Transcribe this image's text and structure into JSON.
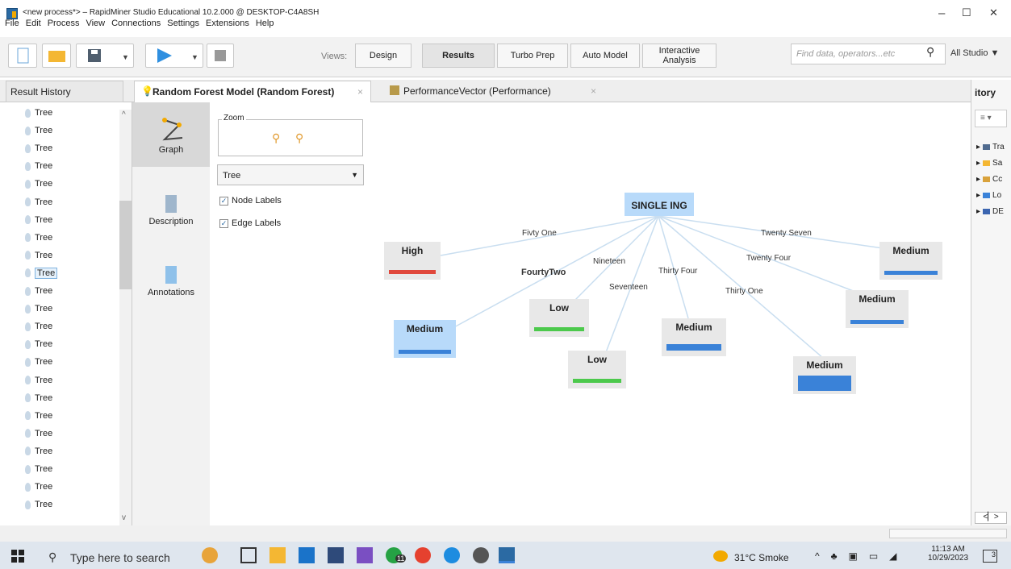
{
  "window": {
    "title": "<new process*> – RapidMiner Studio Educational 10.2.000 @ DESKTOP-C4A8SH",
    "controls": [
      "–",
      "☐",
      "✕"
    ]
  },
  "menu": [
    "File",
    "Edit",
    "Process",
    "View",
    "Connections",
    "Settings",
    "Extensions",
    "Help"
  ],
  "toolbar": {
    "views_label": "Views:",
    "view_tabs": [
      "Design",
      "Results",
      "Turbo Prep",
      "Auto Model",
      "Interactive Analysis"
    ],
    "active_view": "Results",
    "search_placeholder": "Find data, operators...etc",
    "scope": "All Studio ▼"
  },
  "tabs": {
    "result_history": "Result History",
    "open": [
      {
        "label": "Random Forest Model (Random Forest)",
        "active": true
      },
      {
        "label": "PerformanceVector (Performance)",
        "active": false
      }
    ],
    "close": "×"
  },
  "tree_list": {
    "item_label": "Tree",
    "count": 23,
    "selected_index": 9
  },
  "sidebar": {
    "items": [
      "Graph",
      "Description",
      "Annotations"
    ]
  },
  "controls": {
    "zoom_label": "Zoom",
    "select_value": "Tree",
    "node_labels": "Node Labels",
    "edge_labels": "Edge Labels"
  },
  "graph": {
    "root": "SINGLE ING",
    "nodes": [
      "High",
      "Medium",
      "Low",
      "Low",
      "Medium",
      "Medium",
      "Medium",
      "Medium"
    ],
    "edges": [
      "Fivty One",
      "FourtyTwo",
      "Nineteen",
      "Seventeen",
      "Thirty Four",
      "Thirty One",
      "Twenty Four",
      "Twenty Seven"
    ]
  },
  "right_panel": {
    "title": "itory",
    "items": [
      "Tra",
      "Sa",
      "Cc",
      "Lo",
      "DE"
    ]
  },
  "taskbar": {
    "search": "Type here to search",
    "weather": "31°C  Smoke",
    "time": "11:13 AM",
    "date": "10/29/2023",
    "badge": "3",
    "chat_badge": "11"
  },
  "colors": {
    "high": "#e0483c",
    "medium": "#3a82d8",
    "low": "#4cc94c",
    "root_bg": "#b8dafa"
  }
}
